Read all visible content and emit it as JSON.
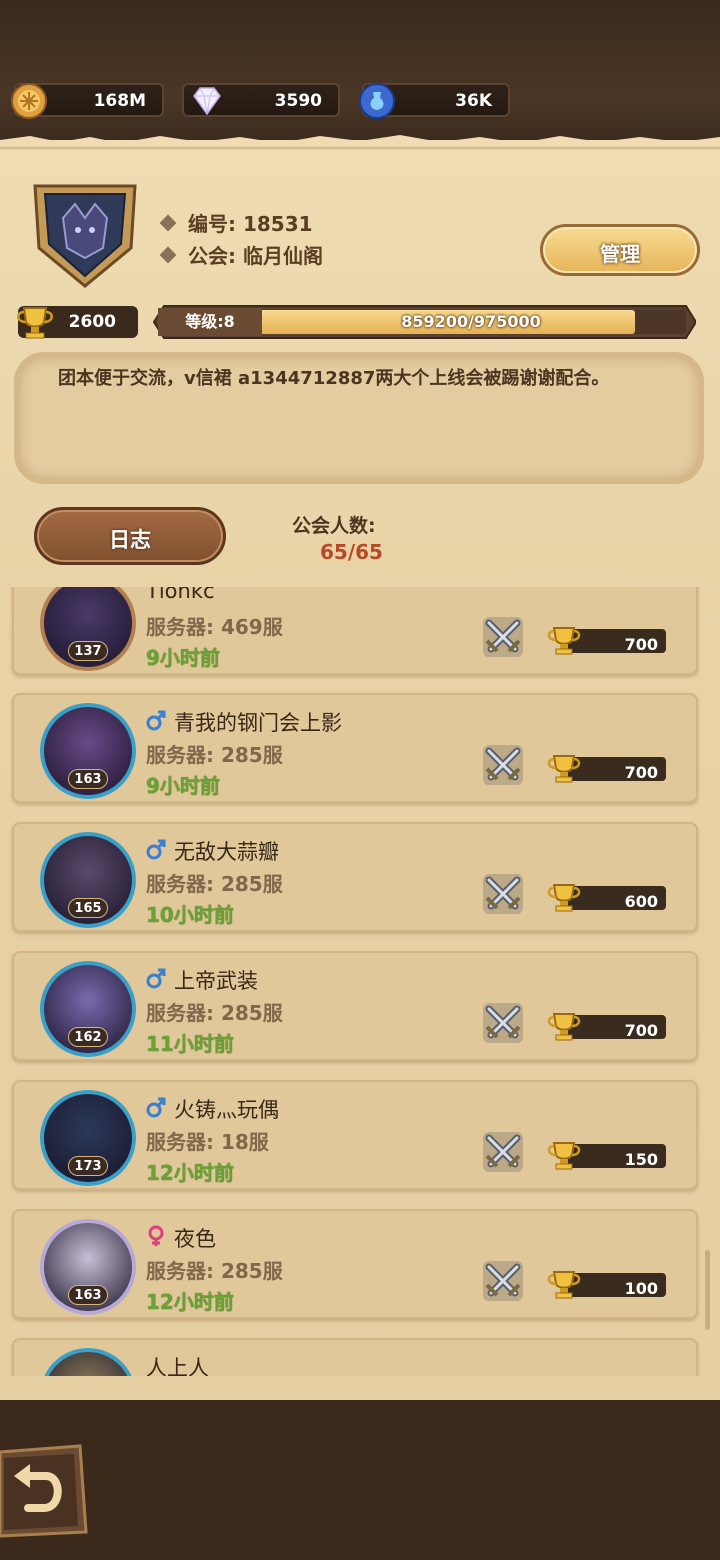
{
  "resources": [
    {
      "icon": "gold-coin-icon",
      "value": "168M"
    },
    {
      "icon": "diamond-gem-icon",
      "value": "3590"
    },
    {
      "icon": "blue-potion-icon",
      "value": "36K"
    }
  ],
  "guild": {
    "id_label": "编号: 18531",
    "name_label": "公会: 临月仙阁",
    "manage_button": "管理",
    "trophies": "2600",
    "level_label": "等级:8",
    "xp_text": "859200/975000",
    "xp_fraction": 0.881,
    "notice": "团本便于交流，v信裙 a1344712887两大个上线会被踢谢谢配合。",
    "log_button": "日志",
    "member_count_label": "公会人数:",
    "member_count": "65/65"
  },
  "members": [
    {
      "name": "Tlonkc",
      "gender": "",
      "server": "服务器: 469服",
      "time": "9小时前",
      "level": "137",
      "trophies": "700",
      "avatar_color": "#4a3a6a"
    },
    {
      "name": "青我的钢门会上影",
      "gender": "male",
      "server": "服务器: 285服",
      "time": "9小时前",
      "level": "163",
      "trophies": "700",
      "avatar_color": "#6a4a8a"
    },
    {
      "name": "无敌大蒜瓣",
      "gender": "male",
      "server": "服务器: 285服",
      "time": "10小时前",
      "level": "165",
      "trophies": "600",
      "avatar_color": "#5a4a6a"
    },
    {
      "name": "上帝武装",
      "gender": "male",
      "server": "服务器: 285服",
      "time": "11小时前",
      "level": "162",
      "trophies": "700",
      "avatar_color": "#7a6ab0"
    },
    {
      "name": "火铸灬玩偶",
      "gender": "male",
      "server": "服务器: 18服",
      "time": "12小时前",
      "level": "173",
      "trophies": "150",
      "avatar_color": "#2a3a5a"
    },
    {
      "name": "夜色",
      "gender": "female",
      "server": "服务器: 285服",
      "time": "12小时前",
      "level": "163",
      "trophies": "100",
      "avatar_color": "#c8c0d8"
    },
    {
      "name": "人上人",
      "gender": "",
      "server": "",
      "time": "",
      "level": "",
      "trophies": "",
      "avatar_color": "#8a7a5a"
    }
  ],
  "colors": {
    "male": "#3a7fd0",
    "female": "#e0407a",
    "time_green": "#6aa233",
    "accent_red": "#b64a24"
  },
  "icons": {
    "back": "back-arrow-icon",
    "swords": "crossed-swords-icon",
    "trophy": "trophy-icon",
    "emblem": "guild-emblem-icon"
  }
}
